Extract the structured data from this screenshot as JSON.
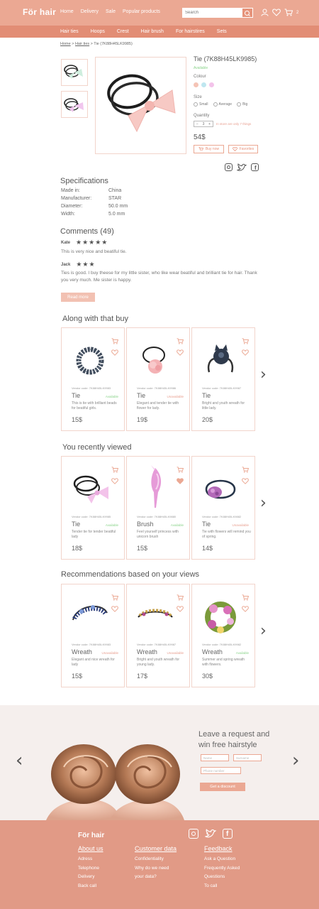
{
  "header": {
    "logo": "För hair",
    "nav": [
      "Home",
      "Delivery",
      "Sale",
      "Popular products"
    ],
    "search_placeholder": "Search",
    "cart_count": "2"
  },
  "categories": [
    "Hair ties",
    "Hoops",
    "Crest",
    "Hair brush",
    "For hairstires",
    "Sets"
  ],
  "breadcrumb": {
    "home": "Home",
    "ties": "Hair ties",
    "current": "Tie (7K88H45LK9985)"
  },
  "product": {
    "title": "Tie (7K88H45LK9985)",
    "availability": "Available",
    "colour_label": "Colour",
    "colours": [
      "#f5c4b6",
      "#bfe7f0",
      "#f3c3ea"
    ],
    "size_label": "Size",
    "sizes": [
      "Small",
      "Average",
      "Big"
    ],
    "quantity_label": "Quantity",
    "quantity": "3",
    "quantity_note": "In store are only 7 things",
    "price": "54$",
    "buy_label": "Buy now",
    "fav_label": "Favorites"
  },
  "specs": {
    "title": "Specifications",
    "rows": [
      {
        "k": "Made in:",
        "v": "China"
      },
      {
        "k": "Manufacturer:",
        "v": "STAR"
      },
      {
        "k": "Diameter:",
        "v": "50.0 mm"
      },
      {
        "k": "Width:",
        "v": "5.0 mm"
      }
    ]
  },
  "comments": {
    "title": "Comments (49)",
    "items": [
      {
        "name": "Kate",
        "stars": "★★★★★",
        "text": "This is very nice and beatiful tie."
      },
      {
        "name": "Jack",
        "stars": "★★★",
        "text": "Ties is good. I buy theese for my little sister, who like wear beatiful and brilliant tie for hair. Thank you very much. Me sister is happy."
      }
    ],
    "read_more": "Read more"
  },
  "sections": [
    {
      "title": "Along with that buy",
      "cards": [
        {
          "code": "Vendor code: 7K88H45LK9983",
          "name": "Tie",
          "status": "Available",
          "ok": true,
          "desc": "This is tie with brilliant beads for beatiful girls.",
          "price": "15$",
          "img": "beads",
          "fav": false
        },
        {
          "code": "Vendor code: 7K88H45LK9986",
          "name": "Tie",
          "status": "Unavailable",
          "ok": false,
          "desc": "Elegant and tender tie with flower for lady.",
          "price": "19$",
          "img": "flower",
          "fav": false
        },
        {
          "code": "Vendor code: 7K88H45LK9987",
          "name": "Tie",
          "status": "",
          "ok": true,
          "desc": "Bright and youth wreath for little lady.",
          "price": "20$",
          "img": "cat",
          "fav": false
        }
      ]
    },
    {
      "title": "You recently viewed",
      "cards": [
        {
          "code": "Vendor code: 7K88H45LK9985",
          "name": "Tie",
          "status": "Available",
          "ok": true,
          "desc": "Tender tie for tender beatiful lady",
          "price": "18$",
          "img": "bow",
          "fav": false
        },
        {
          "code": "Vendor code: 7K88H45LK9880",
          "name": "Brush",
          "status": "Available",
          "ok": true,
          "desc": "Feel yourself princess with unicorn brush",
          "price": "15$",
          "img": "brush",
          "fav": true
        },
        {
          "code": "Vendor code: 7K88H45LK9882",
          "name": "Tie",
          "status": "Unavailable",
          "ok": false,
          "desc": "Tie with flowers will remind you of spring.",
          "price": "14$",
          "img": "violet",
          "fav": false
        }
      ]
    },
    {
      "title": "Recommendations based on your views",
      "cards": [
        {
          "code": "Vendor code: 7K88H45LK9983",
          "name": "Wreath",
          "status": "Unavailable",
          "ok": false,
          "desc": "Elegant and nice wreath for lady",
          "price": "15$",
          "img": "hoopblue",
          "fav": false
        },
        {
          "code": "Vendor code: 7K88H45LK9987",
          "name": "Wreath",
          "status": "Unavailable",
          "ok": false,
          "desc": "Bright and youth wreath for young lady.",
          "price": "17$",
          "img": "hoopgold",
          "fav": false
        },
        {
          "code": "Vendor code: 7K88H45LK9982",
          "name": "Wreath",
          "status": "Available",
          "ok": true,
          "desc": "Summer and spring wreath with flowers.",
          "price": "30$",
          "img": "floral",
          "fav": false
        }
      ]
    }
  ],
  "promo": {
    "title": "Leave a request and win free hairstyle",
    "name_ph": "Name",
    "surname_ph": "Surname",
    "phone_ph": "Phone number",
    "button": "Get a discount"
  },
  "footer": {
    "logo": "För hair",
    "cols": [
      {
        "title": "About us",
        "links": [
          "Adress",
          "Telephone",
          "Delivery",
          "Back call"
        ]
      },
      {
        "title": "Customer data",
        "links": [
          "Confidentiality",
          "Why do we need",
          "your data?"
        ]
      },
      {
        "title": "Feedback",
        "links": [
          "Ask a Question",
          "Frequently Asked",
          "Questions",
          "To call"
        ]
      }
    ]
  }
}
